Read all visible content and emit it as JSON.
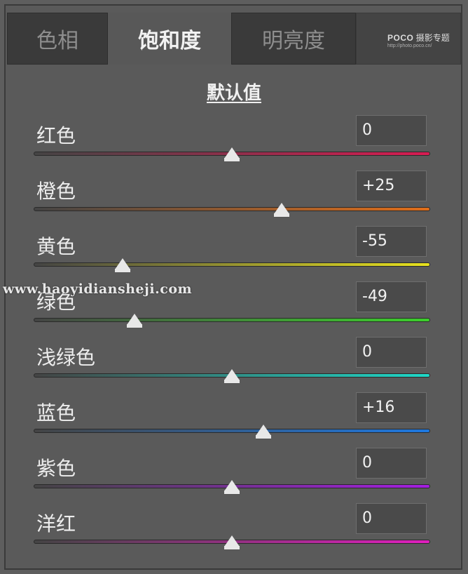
{
  "tabs": [
    {
      "label": "色相",
      "active": false
    },
    {
      "label": "饱和度",
      "active": true
    },
    {
      "label": "明亮度",
      "active": false
    }
  ],
  "watermark_logo": {
    "brand": "POCO",
    "text": "摄影专题",
    "url": "http://photo.poco.cn/"
  },
  "default_label": "默认值",
  "sliders": [
    {
      "label": "红色",
      "value": "0",
      "level": 0,
      "gradient": [
        "#444444",
        "#d81b52"
      ]
    },
    {
      "label": "橙色",
      "value": "+25",
      "level": 25,
      "gradient": [
        "#444444",
        "#e06e1a"
      ]
    },
    {
      "label": "黄色",
      "value": "-55",
      "level": -55,
      "gradient": [
        "#444444",
        "#e8e21e"
      ]
    },
    {
      "label": "绿色",
      "value": "-49",
      "level": -49,
      "gradient": [
        "#444444",
        "#3ccf2c"
      ]
    },
    {
      "label": "浅绿色",
      "value": "0",
      "level": 0,
      "gradient": [
        "#444444",
        "#1ed8c8"
      ]
    },
    {
      "label": "蓝色",
      "value": "+16",
      "level": 16,
      "gradient": [
        "#444444",
        "#1e78e0"
      ]
    },
    {
      "label": "紫色",
      "value": "0",
      "level": 0,
      "gradient": [
        "#444444",
        "#a41ee0"
      ]
    },
    {
      "label": "洋红",
      "value": "0",
      "level": 0,
      "gradient": [
        "#444444",
        "#e01ebe"
      ]
    }
  ],
  "overlay_watermark": "www.haoyidiansheji.com"
}
